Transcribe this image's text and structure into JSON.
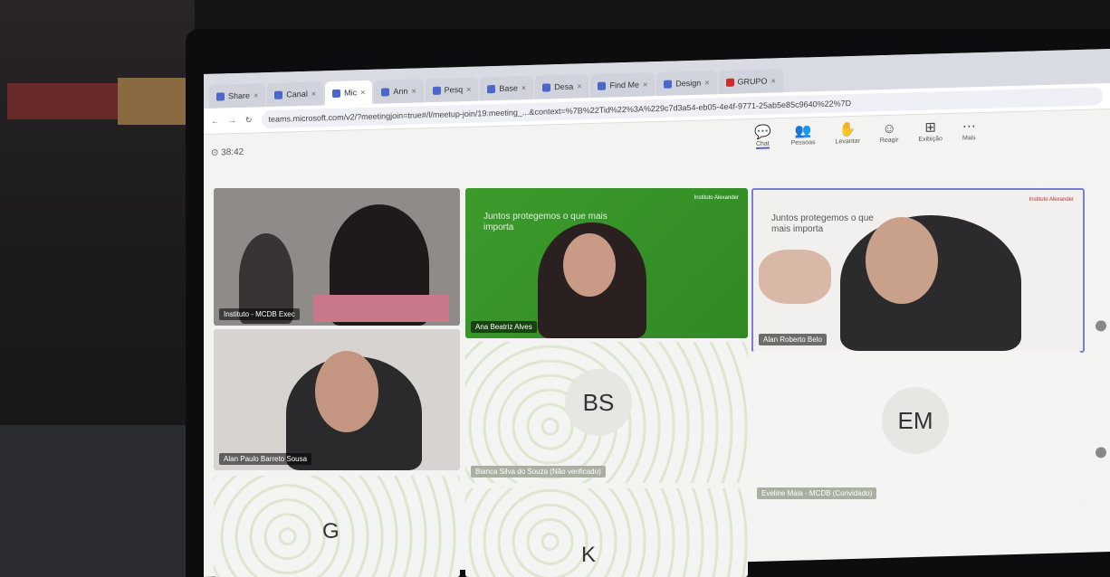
{
  "browser": {
    "tabs": [
      {
        "label": "Share",
        "active": false
      },
      {
        "label": "Canal",
        "active": false
      },
      {
        "label": "Mic",
        "active": true
      },
      {
        "label": "Ann",
        "active": false
      },
      {
        "label": "Pesq",
        "active": false
      },
      {
        "label": "Base",
        "active": false
      },
      {
        "label": "Desa",
        "active": false
      },
      {
        "label": "Find Me",
        "active": false
      },
      {
        "label": "Design",
        "active": false
      },
      {
        "label": "GRUPO",
        "active": false
      }
    ],
    "url": "teams.microsoft.com/v2/?meetingjoin=true#/l/meetup-join/19:meeting_...&context=%7B%22Tid%22%3A%229c7d3a54-eb05-4e4f-9771-25ab5e85c9640%22%7D"
  },
  "meeting": {
    "timer": "38:42",
    "toolbar": [
      {
        "label": "Chat",
        "icon": "chat-icon",
        "glyph": "💬"
      },
      {
        "label": "Pessoas",
        "icon": "people-icon",
        "glyph": "👥"
      },
      {
        "label": "Levantar",
        "icon": "raise-hand-icon",
        "glyph": "✋"
      },
      {
        "label": "Reagir",
        "icon": "react-icon",
        "glyph": "☺"
      },
      {
        "label": "Exibição",
        "icon": "view-icon",
        "glyph": "⊞"
      },
      {
        "label": "Mais",
        "icon": "more-icon",
        "glyph": "⋯"
      }
    ]
  },
  "participants": {
    "p1": {
      "name": "Instituto - MCDB Exec"
    },
    "p2": {
      "name": "Ana Beatriz Alves",
      "slide": "Juntos protegemos o que mais importa",
      "brand": "Instituto Alexander"
    },
    "p3": {
      "name": "Alan Roberto Belo",
      "slide": "Juntos protegemos o que mais importa",
      "brand": "Instituto Alexander"
    },
    "p4": {
      "name": "Alan Paulo Barreto Sousa"
    },
    "p5": {
      "initials": "BS",
      "name": "Bianca Silva do Souza (Não verificado)"
    },
    "p6": {
      "initials": "EM",
      "name": "Eveline Maia - MCDB (Convidado)"
    },
    "p7": {
      "initials": "G"
    },
    "p8": {
      "initials": "K"
    }
  }
}
